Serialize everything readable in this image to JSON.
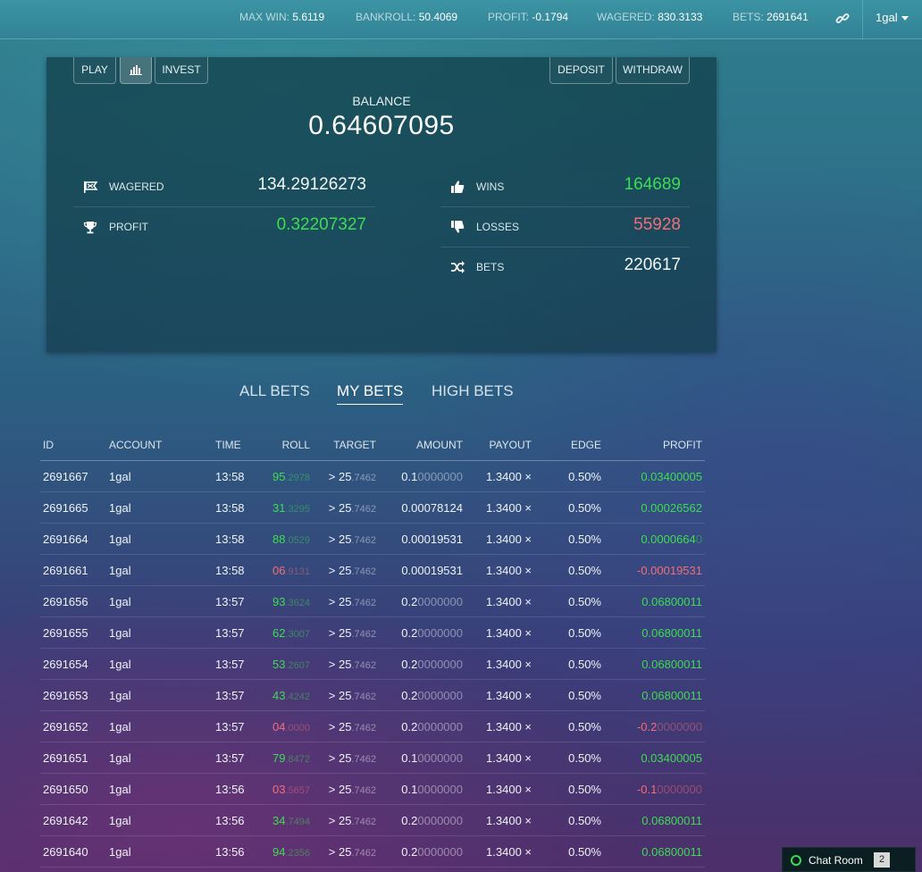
{
  "topbar": {
    "stats": [
      {
        "key": "MAX WIN:",
        "value": "5.6119"
      },
      {
        "key": "BANKROLL:",
        "value": "50.4069"
      },
      {
        "key": "PROFIT:",
        "value": "-0.1794"
      },
      {
        "key": "WAGERED:",
        "value": "830.3133"
      },
      {
        "key": "BETS:",
        "value": "2691641"
      }
    ],
    "link_icon": "link-icon",
    "user": "1gal"
  },
  "panel": {
    "buttons": {
      "play": "PLAY",
      "chart_icon": "bar-chart-icon",
      "invest": "INVEST",
      "deposit": "DEPOSIT",
      "withdraw": "WITHDRAW"
    },
    "balance_label": "BALANCE",
    "balance_value": "0.64607095",
    "left_stats": [
      {
        "icon": "flag-icon",
        "label": "WAGERED",
        "value": "134.29126273"
      },
      {
        "icon": "trophy-icon",
        "label": "PROFIT",
        "value": "0.32207327"
      }
    ],
    "right_stats": [
      {
        "icon": "thumbs-up-icon",
        "label": "WINS",
        "value": "164689"
      },
      {
        "icon": "thumbs-down-icon",
        "label": "LOSSES",
        "value": "55928"
      },
      {
        "icon": "shuffle-icon",
        "label": "BETS",
        "value": "220617"
      }
    ]
  },
  "tabs": [
    "ALL BETS",
    "MY BETS",
    "HIGH BETS"
  ],
  "table": {
    "headers": [
      "ID",
      "ACCOUNT",
      "TIME",
      "ROLL",
      "TARGET",
      "AMOUNT",
      "PAYOUT",
      "EDGE",
      "PROFIT"
    ],
    "rows": [
      {
        "id": "2691667",
        "account": "1gal",
        "time": "13:58",
        "roll_main": "95",
        "roll_dec": ".2978",
        "roll_win": true,
        "target_main": "> 25",
        "target_dec": ".7462",
        "amount_main": "0.1",
        "amount_dim": "0000000",
        "payout": "1.3400 ×",
        "edge": "0.50%",
        "profit_main": "0.03400005",
        "profit_dim": "",
        "profit_win": true
      },
      {
        "id": "2691665",
        "account": "1gal",
        "time": "13:58",
        "roll_main": "31",
        "roll_dec": ".3295",
        "roll_win": true,
        "target_main": "> 25",
        "target_dec": ".7462",
        "amount_main": "0.00078124",
        "amount_dim": "",
        "payout": "1.3400 ×",
        "edge": "0.50%",
        "profit_main": "0.00026562",
        "profit_dim": "",
        "profit_win": true
      },
      {
        "id": "2691664",
        "account": "1gal",
        "time": "13:58",
        "roll_main": "88",
        "roll_dec": ".0529",
        "roll_win": true,
        "target_main": "> 25",
        "target_dec": ".7462",
        "amount_main": "0.00019531",
        "amount_dim": "",
        "payout": "1.3400 ×",
        "edge": "0.50%",
        "profit_main": "0.0000664",
        "profit_dim": "0",
        "profit_win": true
      },
      {
        "id": "2691661",
        "account": "1gal",
        "time": "13:58",
        "roll_main": "06",
        "roll_dec": ".9131",
        "roll_win": false,
        "target_main": "> 25",
        "target_dec": ".7462",
        "amount_main": "0.00019531",
        "amount_dim": "",
        "payout": "1.3400 ×",
        "edge": "0.50%",
        "profit_main": "-0.00019531",
        "profit_dim": "",
        "profit_win": false
      },
      {
        "id": "2691656",
        "account": "1gal",
        "time": "13:57",
        "roll_main": "93",
        "roll_dec": ".3624",
        "roll_win": true,
        "target_main": "> 25",
        "target_dec": ".7462",
        "amount_main": "0.2",
        "amount_dim": "0000000",
        "payout": "1.3400 ×",
        "edge": "0.50%",
        "profit_main": "0.06800011",
        "profit_dim": "",
        "profit_win": true
      },
      {
        "id": "2691655",
        "account": "1gal",
        "time": "13:57",
        "roll_main": "62",
        "roll_dec": ".3007",
        "roll_win": true,
        "target_main": "> 25",
        "target_dec": ".7462",
        "amount_main": "0.2",
        "amount_dim": "0000000",
        "payout": "1.3400 ×",
        "edge": "0.50%",
        "profit_main": "0.06800011",
        "profit_dim": "",
        "profit_win": true
      },
      {
        "id": "2691654",
        "account": "1gal",
        "time": "13:57",
        "roll_main": "53",
        "roll_dec": ".2607",
        "roll_win": true,
        "target_main": "> 25",
        "target_dec": ".7462",
        "amount_main": "0.2",
        "amount_dim": "0000000",
        "payout": "1.3400 ×",
        "edge": "0.50%",
        "profit_main": "0.06800011",
        "profit_dim": "",
        "profit_win": true
      },
      {
        "id": "2691653",
        "account": "1gal",
        "time": "13:57",
        "roll_main": "43",
        "roll_dec": ".4242",
        "roll_win": true,
        "target_main": "> 25",
        "target_dec": ".7462",
        "amount_main": "0.2",
        "amount_dim": "0000000",
        "payout": "1.3400 ×",
        "edge": "0.50%",
        "profit_main": "0.06800011",
        "profit_dim": "",
        "profit_win": true
      },
      {
        "id": "2691652",
        "account": "1gal",
        "time": "13:57",
        "roll_main": "04",
        "roll_dec": ".0000",
        "roll_win": false,
        "target_main": "> 25",
        "target_dec": ".7462",
        "amount_main": "0.2",
        "amount_dim": "0000000",
        "payout": "1.3400 ×",
        "edge": "0.50%",
        "profit_main": "-0.2",
        "profit_dim": "0000000",
        "profit_win": false
      },
      {
        "id": "2691651",
        "account": "1gal",
        "time": "13:57",
        "roll_main": "79",
        "roll_dec": ".8472",
        "roll_win": true,
        "target_main": "> 25",
        "target_dec": ".7462",
        "amount_main": "0.1",
        "amount_dim": "0000000",
        "payout": "1.3400 ×",
        "edge": "0.50%",
        "profit_main": "0.03400005",
        "profit_dim": "",
        "profit_win": true
      },
      {
        "id": "2691650",
        "account": "1gal",
        "time": "13:56",
        "roll_main": "03",
        "roll_dec": ".5657",
        "roll_win": false,
        "target_main": "> 25",
        "target_dec": ".7462",
        "amount_main": "0.1",
        "amount_dim": "0000000",
        "payout": "1.3400 ×",
        "edge": "0.50%",
        "profit_main": "-0.1",
        "profit_dim": "0000000",
        "profit_win": false
      },
      {
        "id": "2691642",
        "account": "1gal",
        "time": "13:56",
        "roll_main": "34",
        "roll_dec": ".7494",
        "roll_win": true,
        "target_main": "> 25",
        "target_dec": ".7462",
        "amount_main": "0.2",
        "amount_dim": "0000000",
        "payout": "1.3400 ×",
        "edge": "0.50%",
        "profit_main": "0.06800011",
        "profit_dim": "",
        "profit_win": true
      },
      {
        "id": "2691640",
        "account": "1gal",
        "time": "13:56",
        "roll_main": "94",
        "roll_dec": ".2356",
        "roll_win": true,
        "target_main": "> 25",
        "target_dec": ".7462",
        "amount_main": "0.2",
        "amount_dim": "0000000",
        "payout": "1.3400 ×",
        "edge": "0.50%",
        "profit_main": "0.06800011",
        "profit_dim": "",
        "profit_win": true
      }
    ]
  },
  "chat": {
    "label": "Chat Room",
    "count": "2"
  },
  "colors": {
    "win": "#3ddc52",
    "loss": "#f06f78",
    "accent": "#2f7f8e"
  }
}
